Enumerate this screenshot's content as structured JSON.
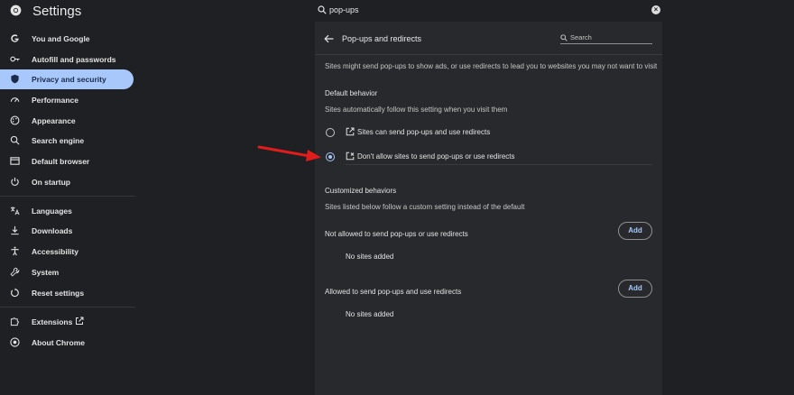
{
  "header": {
    "title": "Settings",
    "search_value": "pop-ups"
  },
  "sidebar": {
    "items": [
      {
        "label": "You and Google",
        "icon": "google-icon"
      },
      {
        "label": "Autofill and passwords",
        "icon": "key-icon"
      },
      {
        "label": "Privacy and security",
        "icon": "shield-icon",
        "active": true
      },
      {
        "label": "Performance",
        "icon": "gauge-icon"
      },
      {
        "label": "Appearance",
        "icon": "palette-icon"
      },
      {
        "label": "Search engine",
        "icon": "search-icon"
      },
      {
        "label": "Default browser",
        "icon": "browser-icon"
      },
      {
        "label": "On startup",
        "icon": "power-icon"
      },
      {
        "label": "Languages",
        "icon": "translate-icon"
      },
      {
        "label": "Downloads",
        "icon": "download-icon"
      },
      {
        "label": "Accessibility",
        "icon": "accessibility-icon"
      },
      {
        "label": "System",
        "icon": "wrench-icon"
      },
      {
        "label": "Reset settings",
        "icon": "reset-icon"
      },
      {
        "label": "Extensions",
        "icon": "puzzle-icon"
      },
      {
        "label": "About Chrome",
        "icon": "chrome-icon"
      }
    ]
  },
  "panel": {
    "title": "Pop-ups and redirects",
    "search_placeholder": "Search",
    "description": "Sites might send pop-ups to show ads, or use redirects to lead you to websites you may not want to visit",
    "default_behavior": {
      "heading": "Default behavior",
      "subtext": "Sites automatically follow this setting when you visit them",
      "options": [
        {
          "label": "Sites can send pop-ups and use redirects",
          "selected": false,
          "icon": "external-link-icon"
        },
        {
          "label": "Don't allow sites to send pop-ups or use redirects",
          "selected": true,
          "icon": "popup-blocked-icon"
        }
      ]
    },
    "customized": {
      "heading": "Customized behaviors",
      "subtext": "Sites listed below follow a custom setting instead of the default",
      "not_allowed": {
        "label": "Not allowed to send pop-ups or use redirects",
        "button": "Add",
        "empty": "No sites added"
      },
      "allowed": {
        "label": "Allowed to send pop-ups and use redirects",
        "button": "Add",
        "empty": "No sites added"
      }
    }
  },
  "colors": {
    "accent": "#a8c7fa",
    "annotation_arrow": "#e01c1c",
    "background": "#1f2023",
    "panel": "#28292c"
  }
}
